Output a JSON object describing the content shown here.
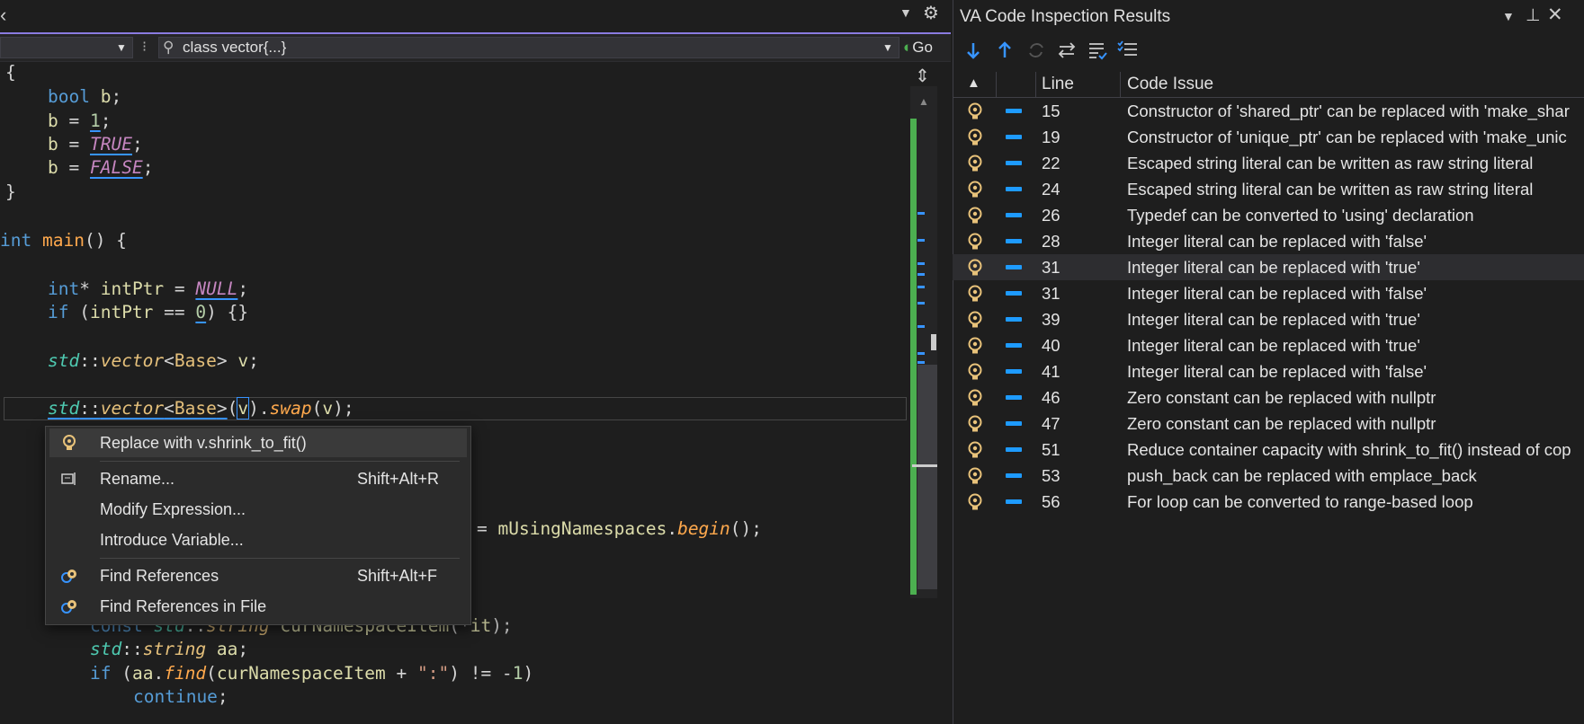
{
  "editor": {
    "nav_scope": "class vector{...}",
    "nav_go": "Go",
    "code_lines": [
      {
        "text": "{"
      },
      {
        "text": "bool b;"
      },
      {
        "text": "b = 1;"
      },
      {
        "text": "b = TRUE;"
      },
      {
        "text": "b = FALSE;"
      },
      {
        "text": "}"
      },
      {
        "text": "int main() {"
      },
      {
        "text": "int* intPtr = NULL;"
      },
      {
        "text": "if (intPtr == 0) {}"
      },
      {
        "text": "std::vector<Base> v;"
      },
      {
        "text": "std::vector<Base>(v).swap(v);"
      },
      {
        "text": "= mUsingNamespaces.begin();"
      },
      {
        "text": "const std::string curNamespaceItem(*it);"
      },
      {
        "text": "std::string aa;"
      },
      {
        "text": "if (aa.find(curNamespaceItem + \":\") != -1)"
      },
      {
        "text": "continue;"
      }
    ]
  },
  "context_menu": {
    "items": [
      {
        "label": "Replace with v.shrink_to_fit()",
        "shortcut": ""
      },
      {
        "label": "Rename...",
        "shortcut": "Shift+Alt+R"
      },
      {
        "label": "Modify Expression...",
        "shortcut": ""
      },
      {
        "label": "Introduce Variable...",
        "shortcut": ""
      },
      {
        "label": "Find References",
        "shortcut": "Shift+Alt+F"
      },
      {
        "label": "Find References in File",
        "shortcut": ""
      }
    ]
  },
  "panel": {
    "title": "VA Code Inspection Results",
    "columns": {
      "sort": "▲",
      "line": "Line",
      "issue": "Code Issue"
    },
    "rows": [
      {
        "line": "15",
        "issue": "Constructor of 'shared_ptr' can be replaced with 'make_shar"
      },
      {
        "line": "19",
        "issue": "Constructor of 'unique_ptr' can be replaced with 'make_unic"
      },
      {
        "line": "22",
        "issue": "Escaped string literal can be written as raw string literal"
      },
      {
        "line": "24",
        "issue": "Escaped string literal can be written as raw string literal"
      },
      {
        "line": "26",
        "issue": "Typedef can be converted to 'using' declaration"
      },
      {
        "line": "28",
        "issue": "Integer literal can be replaced with 'false'"
      },
      {
        "line": "31",
        "issue": "Integer literal can be replaced with 'true'",
        "selected": true
      },
      {
        "line": "31",
        "issue": "Integer literal can be replaced with 'false'"
      },
      {
        "line": "39",
        "issue": "Integer literal can be replaced with 'true'"
      },
      {
        "line": "40",
        "issue": "Integer literal can be replaced with 'true'"
      },
      {
        "line": "41",
        "issue": "Integer literal can be replaced with 'false'"
      },
      {
        "line": "46",
        "issue": "Zero constant can be replaced with nullptr"
      },
      {
        "line": "47",
        "issue": "Zero constant can be replaced with nullptr"
      },
      {
        "line": "51",
        "issue": "Reduce container capacity with shrink_to_fit() instead of cop"
      },
      {
        "line": "53",
        "issue": "push_back can be replaced with emplace_back"
      },
      {
        "line": "56",
        "issue": "For loop can be converted to range-based loop"
      }
    ]
  },
  "colors": {
    "accent": "#8a7be0",
    "marker": "#3794ff",
    "scroll_green": "#4caf50",
    "bulb": "#e8c27a"
  }
}
